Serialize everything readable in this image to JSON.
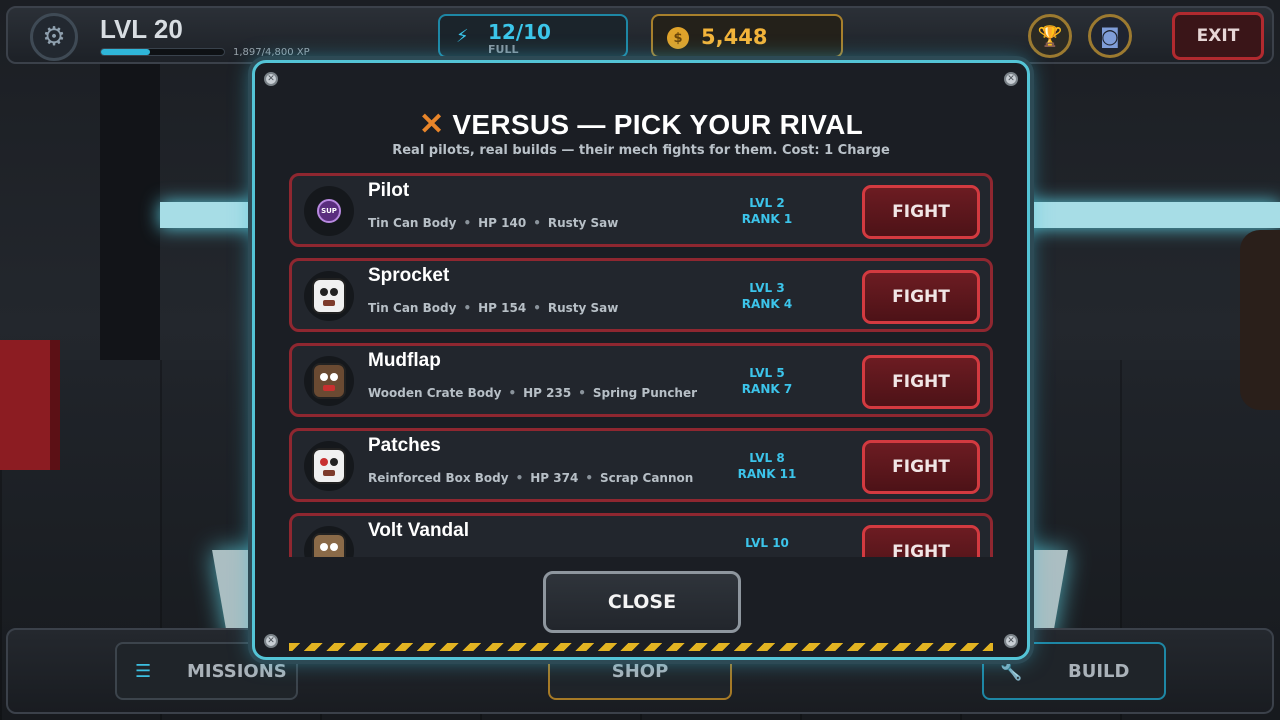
{
  "hud": {
    "level_label": "LVL 20",
    "xp_text": "1,897/4,800 XP",
    "xp_fraction": 0.395,
    "energy_value": "12/10",
    "energy_status": "FULL",
    "coins": "5,448",
    "exit_label": "EXIT",
    "icons": {
      "settings": "gear-icon",
      "energy": "lightning-icon",
      "coin": "coin-icon",
      "trophy": "trophy-icon",
      "robot": "robot-icon"
    }
  },
  "modal": {
    "title": "VERSUS — PICK YOUR RIVAL",
    "subtitle": "Real pilots, real builds — their mech fights for them.  Cost: 1 Charge",
    "close_label": "CLOSE",
    "rivals": [
      {
        "name": "Pilot",
        "body": "Tin Can Body",
        "hp": "HP 140",
        "weapon": "Rusty Saw",
        "level": "LVL 2",
        "rank": "RANK 1",
        "fight_label": "FIGHT",
        "avatar": "sup-badge",
        "badge_text": "SUP"
      },
      {
        "name": "Sprocket",
        "body": "Tin Can Body",
        "hp": "HP 154",
        "weapon": "Rusty Saw",
        "level": "LVL 3",
        "rank": "RANK 4",
        "fight_label": "FIGHT",
        "avatar": "robot-avatar"
      },
      {
        "name": "Mudflap",
        "body": "Wooden Crate Body",
        "hp": "HP 235",
        "weapon": "Spring Puncher",
        "level": "LVL 5",
        "rank": "RANK 7",
        "fight_label": "FIGHT",
        "avatar": "robot-avatar"
      },
      {
        "name": "Patches",
        "body": "Reinforced Box Body",
        "hp": "HP 374",
        "weapon": "Scrap Cannon",
        "level": "LVL 8",
        "rank": "RANK 11",
        "fight_label": "FIGHT",
        "avatar": "robot-avatar"
      },
      {
        "name": "Volt Vandal",
        "level": "LVL 10",
        "fight_label": "FIGHT",
        "avatar": "robot-avatar"
      }
    ]
  },
  "nav": {
    "missions_label": "MISSIONS",
    "shop_label": "SHOP",
    "build_label": "BUILD"
  },
  "colors": {
    "accent_cyan": "#3cc4ea",
    "fight_red": "#d33a40",
    "coin_gold": "#f3b43a",
    "row_border": "#8f2730"
  }
}
